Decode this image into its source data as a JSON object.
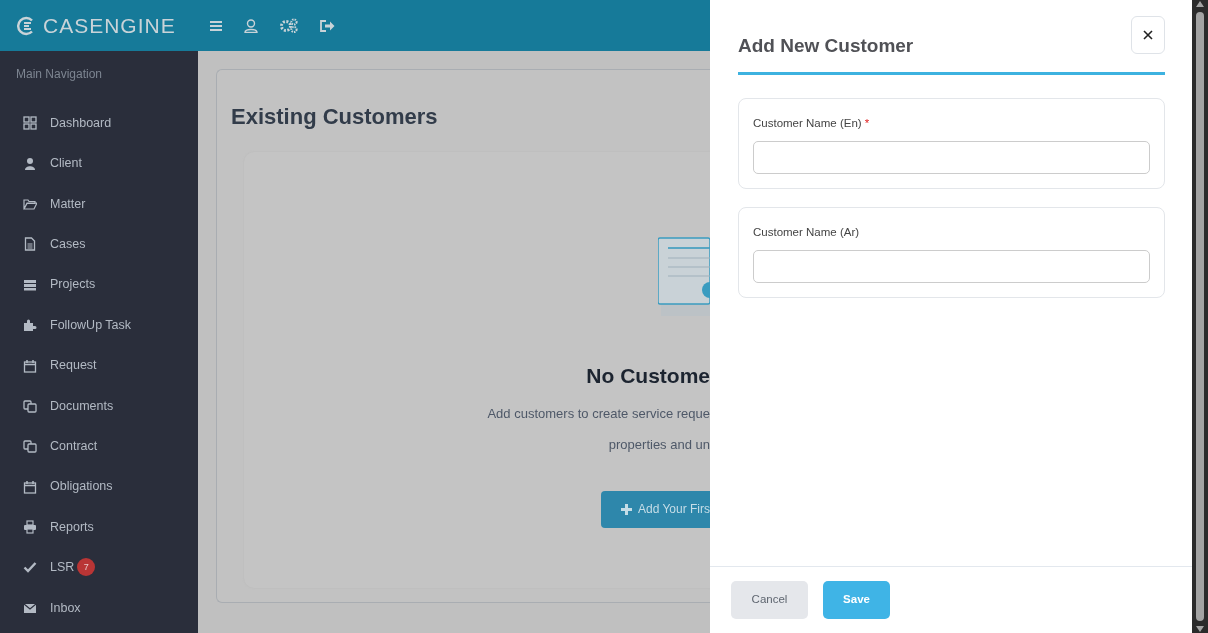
{
  "header": {
    "logo": "CASENGINE"
  },
  "sidebar": {
    "heading": "Main Navigation",
    "items": [
      {
        "label": "Dashboard"
      },
      {
        "label": "Client"
      },
      {
        "label": "Matter"
      },
      {
        "label": "Cases"
      },
      {
        "label": "Projects"
      },
      {
        "label": "FollowUp Task"
      },
      {
        "label": "Request"
      },
      {
        "label": "Documents"
      },
      {
        "label": "Contract"
      },
      {
        "label": "Obligations"
      },
      {
        "label": "Reports"
      },
      {
        "label": "LSR",
        "badge": "7"
      },
      {
        "label": "Inbox"
      }
    ]
  },
  "page": {
    "title": "Existing Customers",
    "empty_state": {
      "heading": "No Custome",
      "lines": [
        "Add customers to create service reque",
        "properties and un"
      ],
      "button": "Add Your Firs"
    }
  },
  "panel": {
    "title": "Add New Customer",
    "fields": [
      {
        "label": "Customer Name (En)",
        "required_mark": "*"
      },
      {
        "label": "Customer Name (Ar)"
      }
    ],
    "buttons": [
      {
        "label": "Cancel",
        "kind": "secondary"
      },
      {
        "label": "Save",
        "kind": "primary"
      }
    ]
  }
}
